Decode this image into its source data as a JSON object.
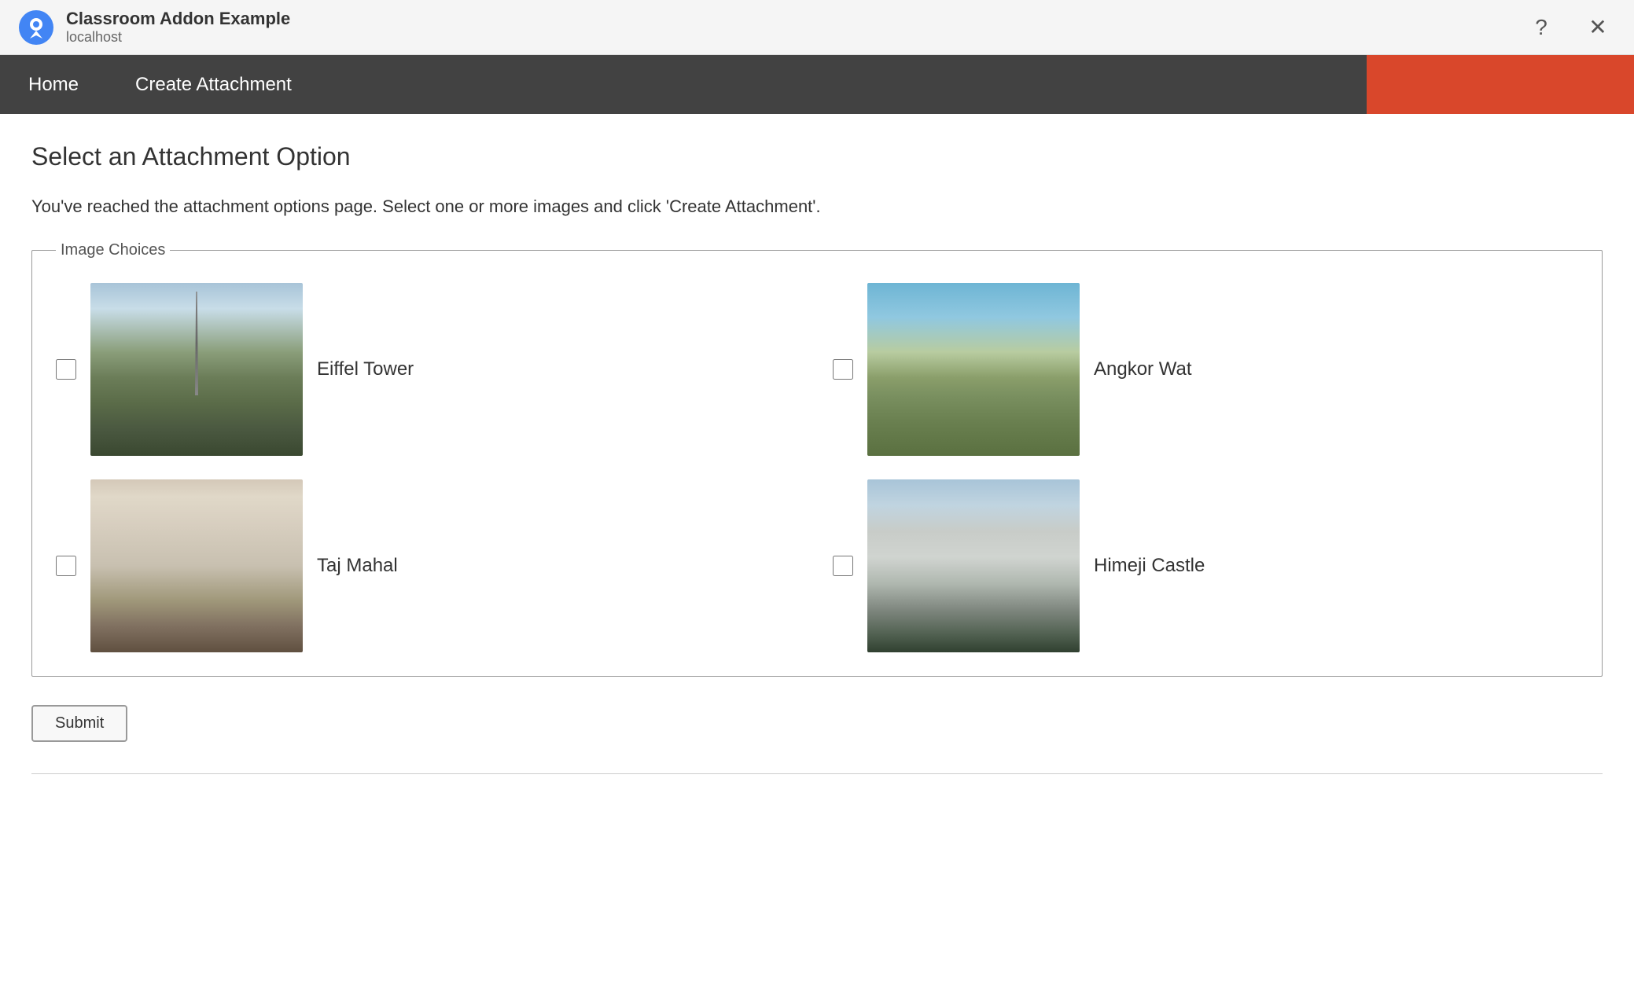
{
  "browser": {
    "title": "Classroom Addon Example",
    "url": "localhost",
    "help_label": "?",
    "close_label": "✕"
  },
  "nav": {
    "home_label": "Home",
    "create_attachment_label": "Create Attachment"
  },
  "page": {
    "title": "Select an Attachment Option",
    "description": "You've reached the attachment options page. Select one or more images and click 'Create Attachment'.",
    "fieldset_legend": "Image Choices",
    "images": [
      {
        "id": "eiffel",
        "label": "Eiffel Tower",
        "checked": false
      },
      {
        "id": "angkor",
        "label": "Angkor Wat",
        "checked": false
      },
      {
        "id": "taj",
        "label": "Taj Mahal",
        "checked": false
      },
      {
        "id": "himeji",
        "label": "Himeji Castle",
        "checked": false
      }
    ],
    "submit_label": "Submit"
  }
}
